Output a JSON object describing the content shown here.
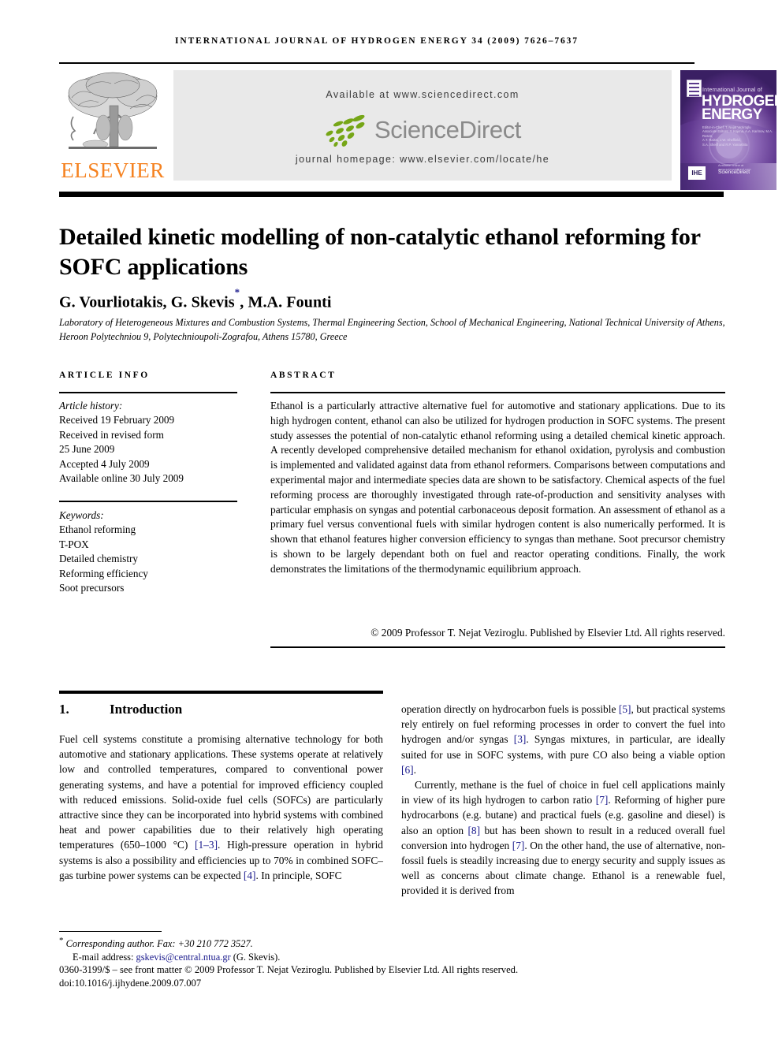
{
  "running_head": "International Journal of Hydrogen Energy 34 (2009) 7626–7637",
  "masthead": {
    "publisher": "ELSEVIER",
    "available_at": "Available at www.sciencedirect.com",
    "sciencedirect_word": "ScienceDirect",
    "journal_homepage": "journal homepage: www.elsevier.com/locate/he",
    "sd_green": "#76a617",
    "elsevier_orange": "#f58220"
  },
  "cover": {
    "line1": "International Journal of",
    "line2": "HYDROGEN",
    "line3": "ENERGY",
    "editors": "Editor-in-Chief:  T. Nejat Veziroglu\nAssociate Editors:  Y. Kojima, A.A. Karimov, M.A. Rosen,\nA.T. Raissi, J.W. Sheffield,\nS.A. Sherif and R.P. Yamashita",
    "ihe_badge": "IHE",
    "sciencedirect_label": "ScienceDirect",
    "sciencedirect_avail": "Available online at www.sciencedirect.com",
    "bg_color": "#4b2a78"
  },
  "article": {
    "title": "Detailed kinetic modelling of non-catalytic ethanol reforming for SOFC applications",
    "authors": "G. Vourliotakis, G. Skevis",
    "authors_star": "*",
    "authors_tail": ", M.A. Founti",
    "affiliation": "Laboratory of Heterogeneous Mixtures and Combustion Systems, Thermal Engineering Section, School of Mechanical Engineering, National Technical University of Athens, Heroon Polytechniou 9, Polytechnioupoli-Zografou, Athens 15780, Greece"
  },
  "info": {
    "header": "Article info",
    "history_label": "Article history:",
    "history": [
      "Received 19 February 2009",
      "Received in revised form",
      "25 June 2009",
      "Accepted 4 July 2009",
      "Available online 30 July 2009"
    ],
    "keywords_label": "Keywords:",
    "keywords": [
      "Ethanol reforming",
      "T-POX",
      "Detailed chemistry",
      "Reforming efficiency",
      "Soot precursors"
    ]
  },
  "abstract": {
    "header": "Abstract",
    "text": "Ethanol is a particularly attractive alternative fuel for automotive and stationary applications. Due to its high hydrogen content, ethanol can also be utilized for hydrogen production in SOFC systems. The present study assesses the potential of non-catalytic ethanol reforming using a detailed chemical kinetic approach. A recently developed comprehensive detailed mechanism for ethanol oxidation, pyrolysis and combustion is implemented and validated against data from ethanol reformers. Comparisons between computations and experimental major and intermediate species data are shown to be satisfactory. Chemical aspects of the fuel reforming process are thoroughly investigated through rate-of-production and sensitivity analyses with particular emphasis on syngas and potential carbonaceous deposit formation. An assessment of ethanol as a primary fuel versus conventional fuels with similar hydrogen content is also numerically performed. It is shown that ethanol features higher conversion efficiency to syngas than methane. Soot precursor chemistry is shown to be largely dependant both on fuel and reactor operating conditions. Finally, the work demonstrates the limitations of the thermodynamic equilibrium approach.",
    "copyright": "© 2009 Professor T. Nejat Veziroglu. Published by Elsevier Ltd. All rights reserved."
  },
  "section": {
    "number": "1.",
    "title": "Introduction"
  },
  "body": {
    "left_para_1_a": "Fuel cell systems constitute a promising alternative technology for both automotive and stationary applications. These systems operate at relatively low and controlled temperatures, compared to conventional power generating systems, and have a potential for improved efficiency coupled with reduced emissions. Solid-oxide fuel cells (SOFCs) are particularly attractive since they can be incorporated into hybrid systems with combined heat and power capabilities due to their relatively high operating temperatures (650–1000 °C) ",
    "left_ref_1": "[1–3]",
    "left_para_1_b": ". High-pressure operation in hybrid systems is also a possibility and efficiencies up to 70% in combined SOFC–gas turbine power systems can be expected ",
    "left_ref_2": "[4]",
    "left_para_1_c": ". In principle, SOFC",
    "right_para_1_a": "operation directly on hydrocarbon fuels is possible ",
    "right_ref_1": "[5]",
    "right_para_1_b": ", but practical systems rely entirely on fuel reforming processes in order to convert the fuel into hydrogen and/or syngas ",
    "right_ref_2": "[3]",
    "right_para_1_c": ". Syngas mixtures, in particular, are ideally suited for use in SOFC systems, with pure CO also being a viable option ",
    "right_ref_3": "[6]",
    "right_para_1_d": ".",
    "right_para_2_a": "Currently, methane is the fuel of choice in fuel cell applications mainly in view of its high hydrogen to carbon ratio ",
    "right_ref_4": "[7]",
    "right_para_2_b": ". Reforming of higher pure hydrocarbons (e.g. butane) and practical fuels (e.g. gasoline and diesel) is also an option ",
    "right_ref_5": "[8]",
    "right_para_2_c": " but has been shown to result in a reduced overall fuel conversion into hydrogen ",
    "right_ref_6": "[7]",
    "right_para_2_d": ". On the other hand, the use of alternative, non-fossil fuels is steadily increasing due to energy security and supply issues as well as concerns about climate change. Ethanol is a renewable fuel, provided it is derived from"
  },
  "footer": {
    "star": "*",
    "corresponding": "Corresponding author. Fax: +30 210 772 3527.",
    "email_label": "E-mail address:",
    "email": "gskevis@central.ntua.gr",
    "email_owner": "(G. Skevis).",
    "issn_line": "0360-3199/$ – see front matter © 2009 Professor T. Nejat Veziroglu. Published by Elsevier Ltd. All rights reserved.",
    "doi": "doi:10.1016/j.ijhydene.2009.07.007",
    "link_color": "#1a1a8c"
  }
}
